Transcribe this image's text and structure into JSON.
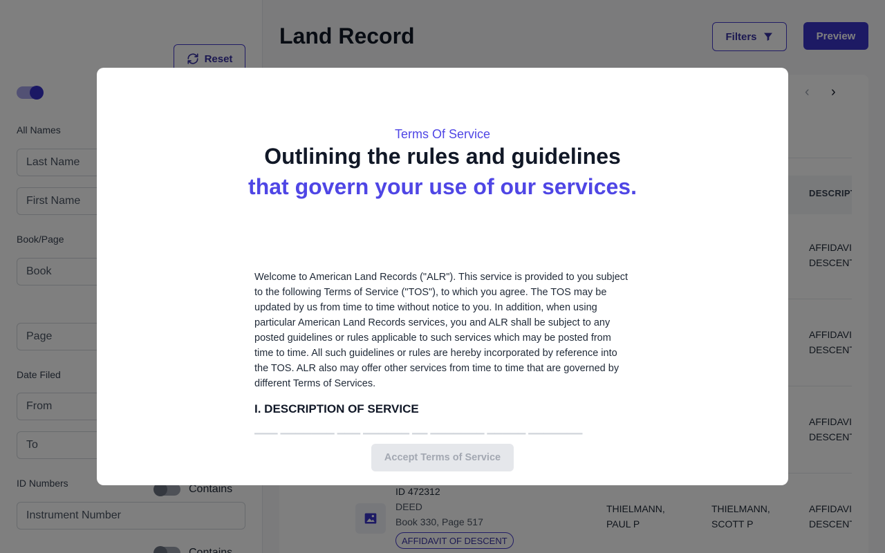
{
  "sidebar": {
    "reset_label": "Reset",
    "all_names_label": "All Names",
    "last_name_placeholder": "Last Name",
    "first_name_placeholder": "First Name",
    "book_page_label": "Book/Page",
    "book_placeholder": "Book",
    "page_placeholder": "Page",
    "date_filed_label": "Date Filed",
    "from_placeholder": "From",
    "to_placeholder": "To",
    "id_numbers_label": "ID Numbers",
    "contains_label": "Contains",
    "instrument_placeholder": "Instrument Number",
    "contains_label_2": "Contains"
  },
  "main": {
    "title": "Land Record",
    "filters_label": "Filters",
    "preview_label": "Preview"
  },
  "table": {
    "col_description": "DESCRIPT",
    "rows": [
      {
        "desc1": "AFFIDAVI",
        "desc2": "DESCENT"
      },
      {
        "desc1": "AFFIDAVI",
        "desc2": "DESCENT"
      },
      {
        "desc1": "AFFIDAVI",
        "desc2": "DESCENT"
      },
      {
        "id": "ID 472312",
        "type": "DEED",
        "book_page": "Book 330, Page 517",
        "tag": "AFFIDAVIT OF DESCENT",
        "party1_line1": "THIELMANN,",
        "party1_line2": "PAUL P",
        "party2_line1": "THIELMANN,",
        "party2_line2": "SCOTT P",
        "desc1": "AFFIDAVI",
        "desc2": "DESCENT"
      }
    ]
  },
  "modal": {
    "eyebrow": "Terms Of Service",
    "title_line1": "Outlining the rules and guidelines",
    "title_line2": "that govern your use of our services.",
    "body": "Welcome to American Land Records (\"ALR\"). This service is provided to you subject to the following Terms of Service (\"TOS\"), to which you agree. The TOS may be updated by us from time to time without notice to you. In addition, when using particular American Land Records services, you and ALR shall be subject to any posted guidelines or rules applicable to such services which may be posted from time to time. All such guidelines or rules are hereby incorporated by reference into the TOS. ALR also may offer other services from time to time that are governed by different Terms of Services.",
    "section_heading": "I. DESCRIPTION OF SERVICE",
    "accept_label": "Accept Terms of Service"
  },
  "colors": {
    "accent": "#4f46e5",
    "primary_button": "#3b35c9",
    "disabled_button": "#e5e7eb"
  }
}
